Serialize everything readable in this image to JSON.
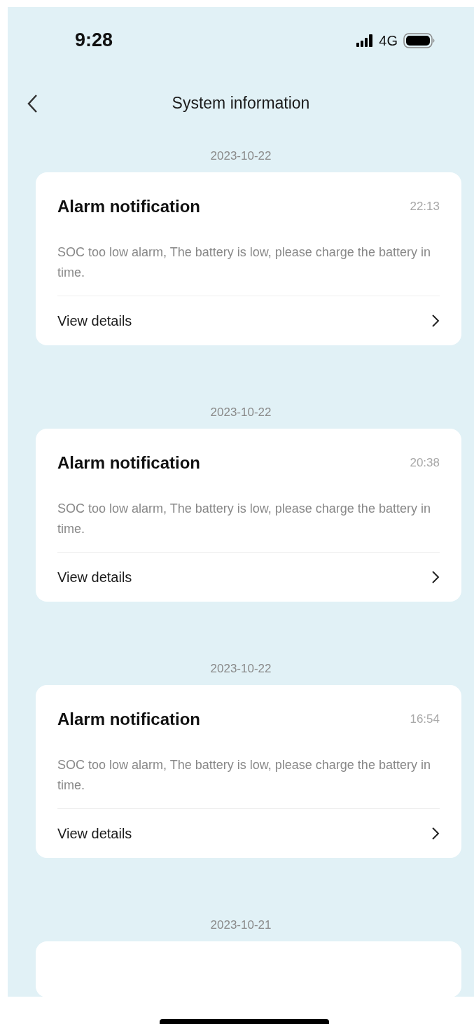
{
  "status_bar": {
    "time": "9:28",
    "network": "4G"
  },
  "header": {
    "title": "System information"
  },
  "messages": [
    {
      "kind": "full",
      "date": "2023-10-22",
      "title": "Alarm notification",
      "time": "22:13",
      "text": "SOC too low alarm, The battery is low, please charge the battery in time.",
      "link": "View details"
    },
    {
      "kind": "full",
      "date": "2023-10-22",
      "title": "Alarm notification",
      "time": "20:38",
      "text": "SOC too low alarm, The battery is low, please charge the battery in time.",
      "link": "View details"
    },
    {
      "kind": "full",
      "date": "2023-10-22",
      "title": "Alarm notification",
      "time": "16:54",
      "text": "SOC too low alarm, The battery is low, please charge the battery in time.",
      "link": "View details"
    },
    {
      "kind": "partial",
      "date": "2023-10-21"
    }
  ]
}
